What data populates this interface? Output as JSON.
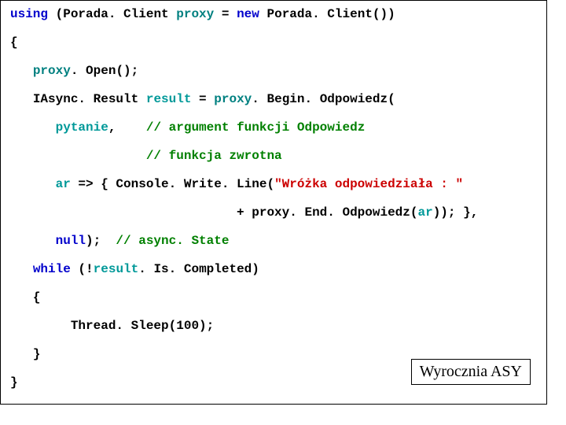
{
  "colors": {
    "blue": "#0000cc",
    "teal": "#008080",
    "red": "#cc0000",
    "green": "#008000",
    "cyan": "#009999"
  },
  "lines": {
    "l1_using": "using",
    "l1_open": " (Porada. Client ",
    "l1_proxy": "proxy",
    "l1_eq": " = ",
    "l1_new": "new",
    "l1_ctor": " Porada. Client())",
    "l2": "{",
    "l3_proxy": "proxy",
    "l3_open": ". Open();",
    "l4_type": "IAsync. Result ",
    "l4_result": "result",
    "l4_eq": " = ",
    "l4_proxy": "proxy",
    "l4_call": ". Begin. Odpowiedz(",
    "l5_arg": "pytanie",
    "l5_sep": ",    ",
    "l5_cmt": "// argument funkcji Odpowiedz",
    "l6_cmt": "// funkcja zwrotna",
    "l7_ar": "ar",
    "l7_arrow": " => { Console. Write. Line(",
    "l7_str": "\"Wróżka odpowiedziała : \"",
    "l8_plus": "+ proxy. End. Odpowiedz(",
    "l8_ar": "ar",
    "l8_end": ")); },",
    "l9_null": "null",
    "l9_close": ");  ",
    "l9_cmt": "// async. State",
    "l10_while": "while",
    "l10_cond": " (!",
    "l10_result": "result",
    "l10_rest": ". Is. Completed)",
    "l11": "{",
    "l12": "Thread. Sleep(100);",
    "l13": "}",
    "l14": "}"
  },
  "label": "Wyrocznia ASY"
}
